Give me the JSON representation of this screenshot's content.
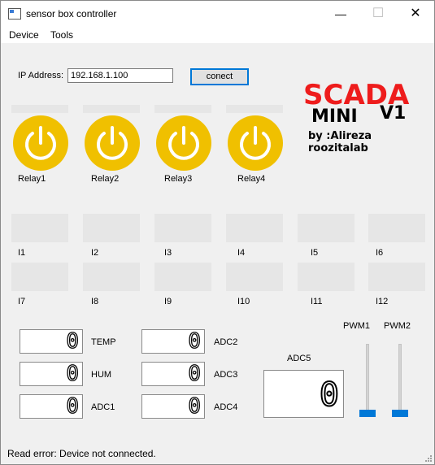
{
  "window": {
    "title": "sensor box controller",
    "minimize": "—",
    "maximize": "☐",
    "close": "✕"
  },
  "menu": {
    "items": [
      "Device",
      "Tools"
    ]
  },
  "connection": {
    "ip_label": "IP Address:",
    "ip_value": "192.168.1.100",
    "connect_label": "conect"
  },
  "branding": {
    "title": "SCADA",
    "subtitle": "MINI",
    "version": "V1",
    "author": "by :Alireza roozitalab"
  },
  "relays": [
    {
      "label": "Relay1",
      "icon": "power-icon"
    },
    {
      "label": "Relay2",
      "icon": "power-icon"
    },
    {
      "label": "Relay3",
      "icon": "power-icon"
    },
    {
      "label": "Relay4",
      "icon": "power-icon"
    }
  ],
  "inputs": [
    "I1",
    "I2",
    "I3",
    "I4",
    "I5",
    "I6",
    "I7",
    "I8",
    "I9",
    "I10",
    "I11",
    "I12"
  ],
  "sensors": {
    "temp": {
      "label": "TEMP",
      "value": "0"
    },
    "hum": {
      "label": "HUM",
      "value": "0"
    },
    "adc1": {
      "label": "ADC1",
      "value": "0"
    },
    "adc2": {
      "label": "ADC2",
      "value": "0"
    },
    "adc3": {
      "label": "ADC3",
      "value": "0"
    },
    "adc4": {
      "label": "ADC4",
      "value": "0"
    },
    "adc5": {
      "label": "ADC5",
      "value": "0"
    }
  },
  "pwm": [
    {
      "label": "PWM1",
      "level": 0
    },
    {
      "label": "PWM2",
      "level": 0
    }
  ],
  "status": {
    "text": "Read error: Device not connected."
  },
  "colors": {
    "relay": "#f0c000",
    "brand_red": "#ee1c1c",
    "accent": "#0078d7",
    "input_box": "#e6e6e6"
  }
}
